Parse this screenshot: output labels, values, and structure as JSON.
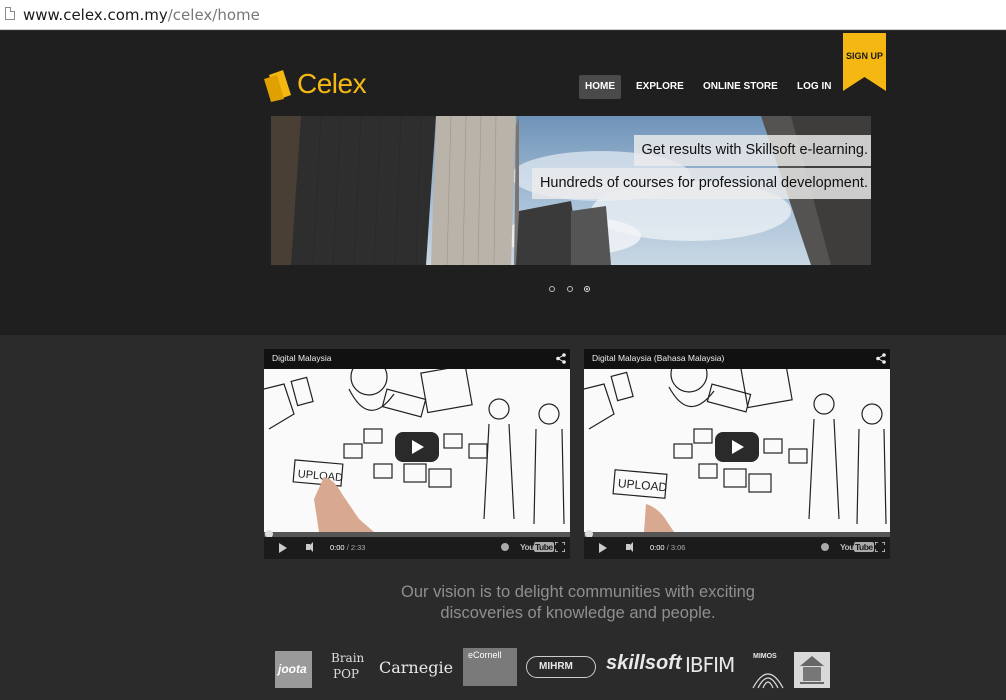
{
  "browser": {
    "url_domain": "www.celex.com.my",
    "url_path": "/celex/home"
  },
  "header": {
    "logo_text": "Celex",
    "nav": [
      {
        "label": "HOME",
        "active": true
      },
      {
        "label": "EXPLORE",
        "active": false
      },
      {
        "label": "ONLINE STORE",
        "active": false
      },
      {
        "label": "LOG IN",
        "active": false
      }
    ],
    "signup_label": "SIGN UP"
  },
  "hero": {
    "caption_1": "Get results with Skillsoft e-learning.",
    "caption_2": "Hundreds of courses for professional development.",
    "slide_count": 3,
    "active_slide": 3
  },
  "videos": [
    {
      "title": "Digital Malaysia",
      "current_time": "0:00",
      "duration": "/ 2:33"
    },
    {
      "title": "Digital Malaysia (Bahasa Malaysia)",
      "current_time": "0:00",
      "duration": "/ 3:06"
    }
  ],
  "vision": {
    "line_1": "Our vision is to delight communities with exciting",
    "line_2": "discoveries of knowledge and people."
  },
  "partners": {
    "joota": "joota",
    "brainpop_1": "Brain",
    "brainpop_2": "POP",
    "carnegie": "Carnegie",
    "ecornell": "eCornell",
    "mihrm": "MIHRM",
    "skillsoft": "skillsoft",
    "ibfim": "IBFIM",
    "mimos": "MIMOS"
  },
  "colors": {
    "brand_yellow": "#f5b812",
    "page_bg": "#2b2b2b",
    "header_bg": "#1f1f1f"
  }
}
